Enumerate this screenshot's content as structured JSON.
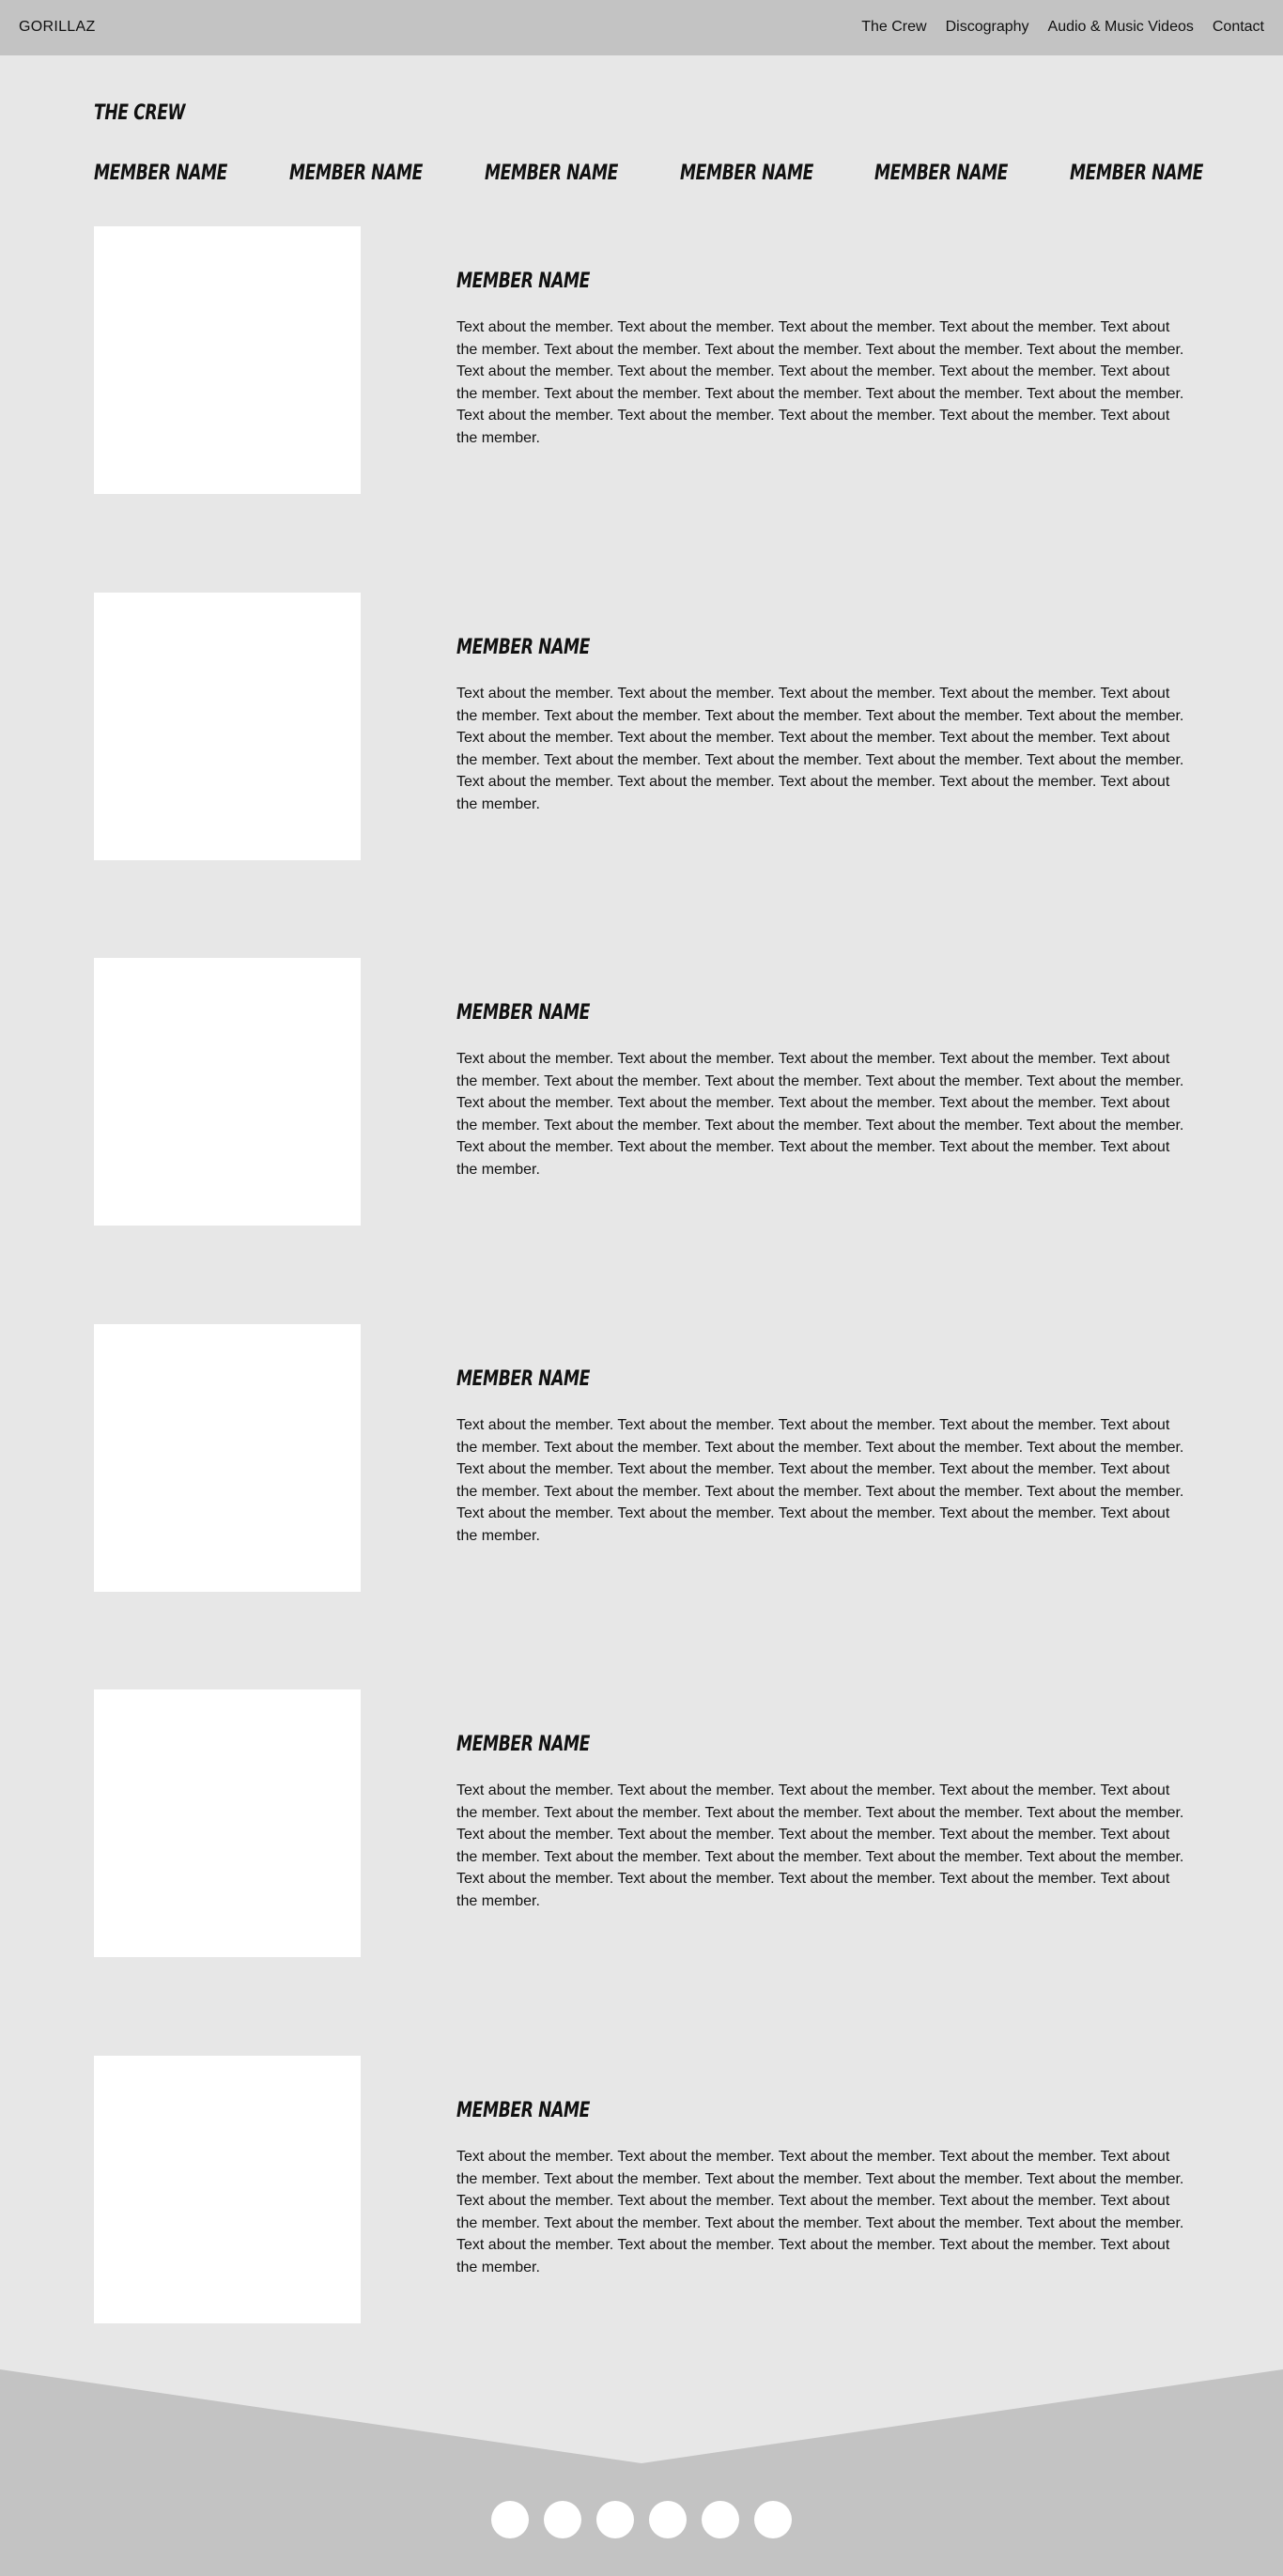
{
  "nav": {
    "brand": "GORILLAZ",
    "links": [
      "The Crew",
      "Discography",
      "Audio & Music Videos",
      "Contact"
    ]
  },
  "crew": {
    "title": "THE CREW",
    "strip": [
      "MEMBER NAME",
      "MEMBER NAME",
      "MEMBER NAME",
      "MEMBER NAME",
      "MEMBER NAME",
      "MEMBER NAME"
    ],
    "members": [
      {
        "name": "MEMBER NAME",
        "text": "Text about the member. Text about the member. Text about the member. Text about the member. Text about the member. Text about the member. Text about the member. Text about the member. Text about the member. Text about the member. Text about the member. Text about the member. Text about the member. Text about the member. Text about the member. Text about the member. Text about the member. Text about the member. Text about the member. Text about the member. Text about the member. Text about the member. Text about the member."
      },
      {
        "name": "MEMBER NAME",
        "text": "Text about the member. Text about the member. Text about the member. Text about the member. Text about the member. Text about the member. Text about the member. Text about the member. Text about the member. Text about the member. Text about the member. Text about the member. Text about the member. Text about the member. Text about the member. Text about the member. Text about the member. Text about the member. Text about the member. Text about the member. Text about the member. Text about the member. Text about the member."
      },
      {
        "name": "MEMBER NAME",
        "text": "Text about the member. Text about the member. Text about the member. Text about the member. Text about the member. Text about the member. Text about the member. Text about the member. Text about the member. Text about the member. Text about the member. Text about the member. Text about the member. Text about the member. Text about the member. Text about the member. Text about the member. Text about the member. Text about the member. Text about the member. Text about the member. Text about the member. Text about the member."
      },
      {
        "name": "MEMBER NAME",
        "text": "Text about the member. Text about the member. Text about the member. Text about the member. Text about the member. Text about the member. Text about the member. Text about the member. Text about the member. Text about the member. Text about the member. Text about the member. Text about the member. Text about the member. Text about the member. Text about the member. Text about the member. Text about the member. Text about the member. Text about the member. Text about the member. Text about the member. Text about the member."
      },
      {
        "name": "MEMBER NAME",
        "text": "Text about the member. Text about the member. Text about the member. Text about the member. Text about the member. Text about the member. Text about the member. Text about the member. Text about the member. Text about the member. Text about the member. Text about the member. Text about the member. Text about the member. Text about the member. Text about the member. Text about the member. Text about the member. Text about the member. Text about the member. Text about the member. Text about the member. Text about the member."
      },
      {
        "name": "MEMBER NAME",
        "text": "Text about the member. Text about the member. Text about the member. Text about the member. Text about the member. Text about the member. Text about the member. Text about the member. Text about the member. Text about the member. Text about the member. Text about the member. Text about the member. Text about the member. Text about the member. Text about the member. Text about the member. Text about the member. Text about the member. Text about the member. Text about the member. Text about the member. Text about the member."
      }
    ]
  },
  "footer": {
    "social_icons": [
      "social-icon-1",
      "social-icon-2",
      "social-icon-3",
      "social-icon-4",
      "social-icon-5",
      "social-icon-6"
    ]
  },
  "colors": {
    "page_bg": "#e7e7e7",
    "nav_bg": "#c3c3c3",
    "footer_bg": "#c3c3c3",
    "placeholder": "#ffffff"
  }
}
